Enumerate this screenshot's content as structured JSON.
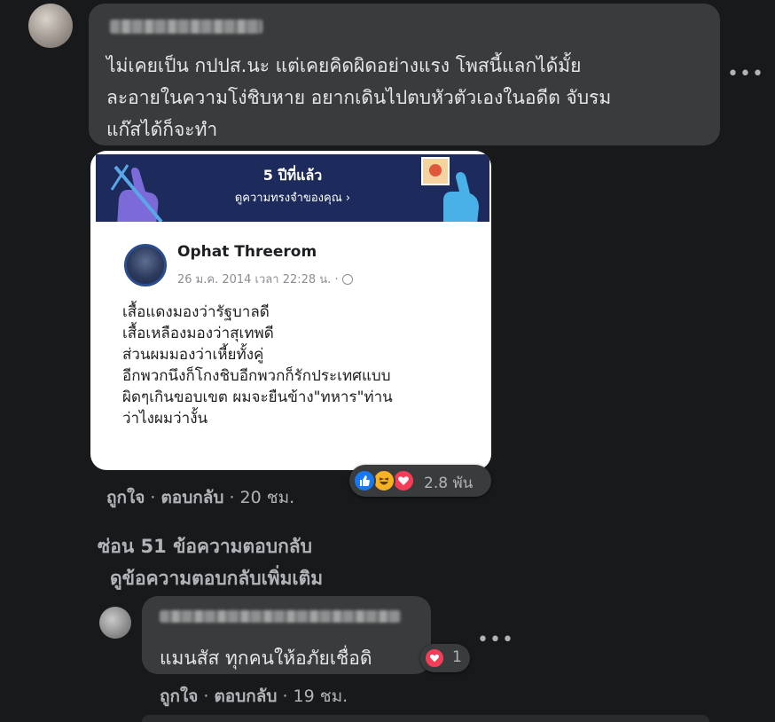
{
  "main_comment": {
    "author_name_hidden": "blurred",
    "text_lines": [
      "ไม่เคยเป็น กปปส.นะ แต่เคยคิดผิดอย่างแรง โพสนี้แลกได้มั้ย",
      "ละอายในความโง่ชิบหาย อยากเดินไปตบหัวตัวเองในอดีต จับรม",
      "แก๊สได้ก็จะทำ"
    ],
    "memory_card": {
      "title": "5 ปีที่แล้ว",
      "subtitle": "ดูความทรงจำของคุณ ›",
      "post_author": "Ophat Threerom",
      "post_meta": "26 ม.ค. 2014 เวลา 22:28 น. ·",
      "post_lines": [
        "เสื้อแดงมองว่ารัฐบาลดี",
        "เสื้อเหลืองมองว่าสุเทพดี",
        "ส่วนผมมองว่าเหี้ยทั้งคู่",
        "อีกพวกนึงก็โกงชิบอีกพวกก็รักประเทศแบบ",
        "ผิดๆเกินขอบเขต ผมจะยืนข้าง\"ทหาร\"ท่าน",
        "ว่าไงผมว่างั้น"
      ]
    },
    "reactions": {
      "icons": [
        "like-icon",
        "haha-icon",
        "love-icon"
      ],
      "count": "2.8 พัน"
    },
    "actions": {
      "like": "ถูกใจ",
      "reply": "ตอบกลับ",
      "time": "20 ชม."
    }
  },
  "thread": {
    "hidden_replies": "ซ่อน 51 ข้อความตอบกลับ",
    "more_replies": "ดูข้อความตอบกลับเพิ่มเติม"
  },
  "reply_comment": {
    "author_name_hidden": "blurred",
    "text": "แมนสัส ทุกคนให้อภัยเชื่อดิ",
    "reaction_count": "1",
    "actions": {
      "like": "ถูกใจ",
      "reply": "ตอบกลับ",
      "time": "19 ชม."
    }
  },
  "ui": {
    "more_glyph": "•••",
    "separator": "·",
    "colors": {
      "background": "#18191a",
      "bubble": "#3a3b3c",
      "text": "#e4e6eb",
      "secondary_text": "#b0b3b8",
      "memory_header": "#1c2a5c",
      "like_blue": "#1877f2",
      "love_red": "#f33e58",
      "haha_yellow": "#f7b125"
    }
  }
}
